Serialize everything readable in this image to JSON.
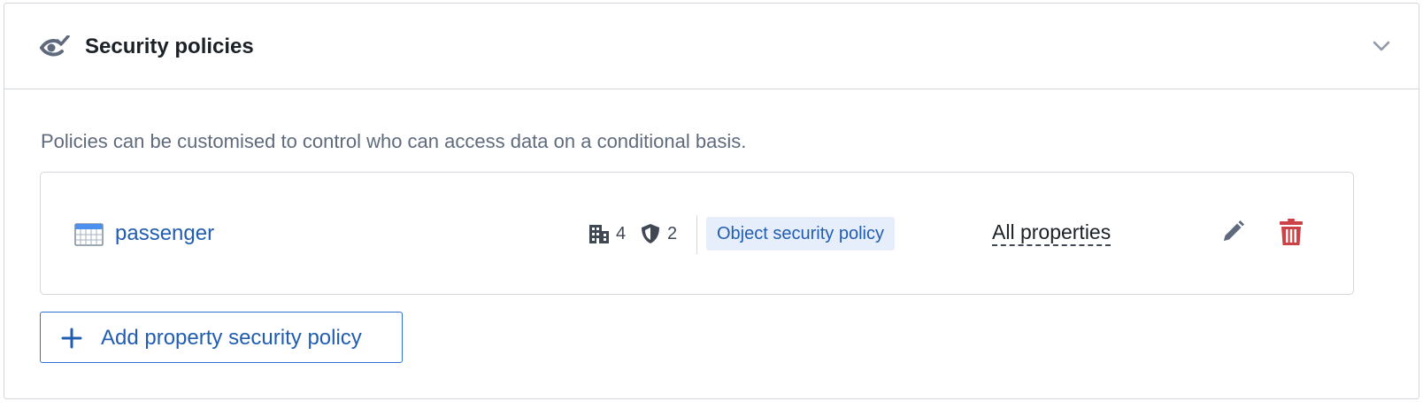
{
  "panel": {
    "title": "Security policies",
    "header_icon": "eye-check-icon",
    "collapse_icon": "chevron-down-icon"
  },
  "description": "Policies can be customised to control who can access data on a conditional basis.",
  "policy": {
    "object_icon": "table-icon",
    "object_name": "passenger",
    "organizations_icon": "building-icon",
    "organizations_count": "4",
    "markings_icon": "shield-icon",
    "markings_count": "2",
    "policy_type": "Object security policy",
    "properties_link": "All properties",
    "edit_icon": "pencil-icon",
    "delete_icon": "trash-icon"
  },
  "add_button": {
    "icon": "plus-icon",
    "label": "Add property security policy"
  },
  "colors": {
    "link_blue": "#215db0",
    "primary_blue": "#2d72d2",
    "danger_red": "#cd4246",
    "tag_bg": "#e6eefb",
    "text_dark": "#1c2127",
    "text_muted": "#5f6b7c",
    "border": "#d3d8de"
  }
}
